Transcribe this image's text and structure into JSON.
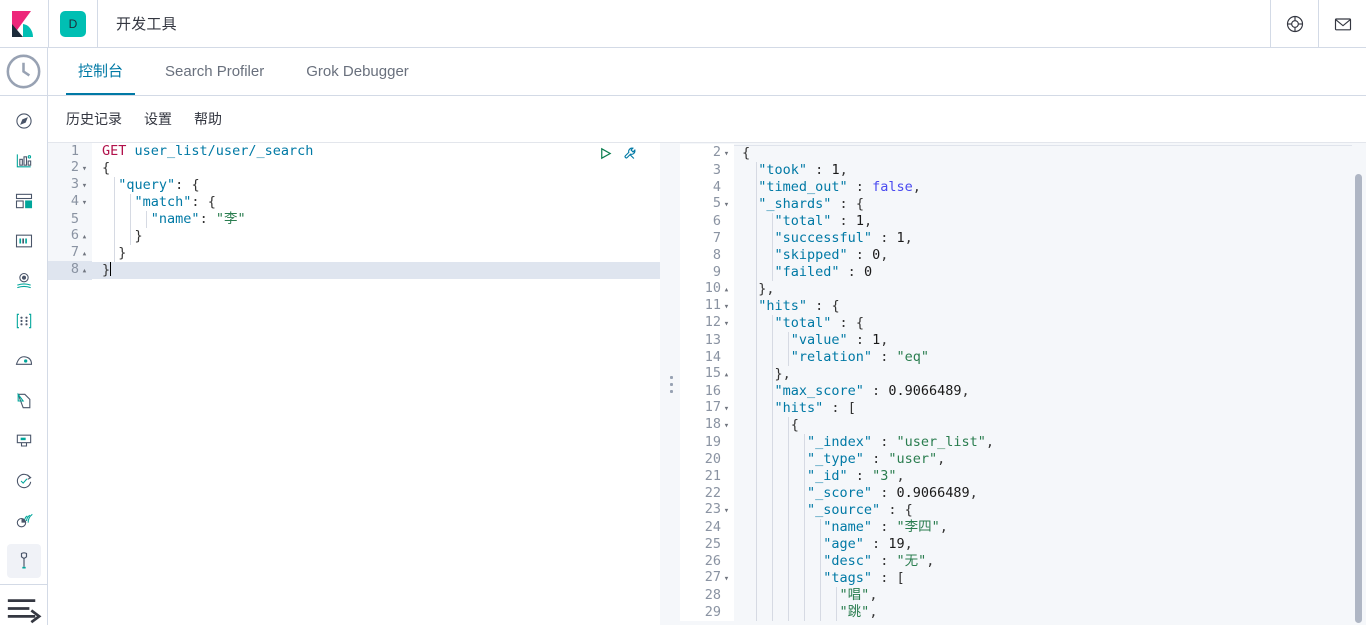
{
  "header": {
    "logo_icon": "kibana-logo",
    "space_badge": "D",
    "title": "开发工具",
    "help_icon": "lifebuoy-icon",
    "mail_icon": "envelope-icon"
  },
  "sidebar": {
    "recent_icon": "clock-icon",
    "items": [
      {
        "icon": "compass-icon",
        "name": "discover"
      },
      {
        "icon": "bar-chart-icon",
        "name": "visualize"
      },
      {
        "icon": "dashboard-icon",
        "name": "dashboard"
      },
      {
        "icon": "canvas-icon",
        "name": "canvas"
      },
      {
        "icon": "map-marker-icon",
        "name": "maps"
      },
      {
        "icon": "ml-nodes-icon",
        "name": "machine-learning"
      },
      {
        "icon": "apm-icon",
        "name": "apm"
      },
      {
        "icon": "logs-icon",
        "name": "logs"
      },
      {
        "icon": "metrics-icon",
        "name": "metrics"
      },
      {
        "icon": "uptime-icon",
        "name": "uptime"
      },
      {
        "icon": "siem-icon",
        "name": "siem"
      },
      {
        "icon": "wrench-icon",
        "name": "dev-tools",
        "active": true
      }
    ],
    "collapse_icon": "collapse-arrow-icon"
  },
  "tabs": [
    {
      "label": "控制台",
      "active": true
    },
    {
      "label": "Search Profiler",
      "active": false
    },
    {
      "label": "Grok Debugger",
      "active": false
    }
  ],
  "submenu": [
    {
      "label": "历史记录"
    },
    {
      "label": "设置"
    },
    {
      "label": "帮助"
    }
  ],
  "request_editor": {
    "play_icon": "play-triangle-icon",
    "wrench_icon": "wrench-icon",
    "active_line": 8,
    "lines": [
      {
        "n": "1",
        "fold": "",
        "indent": 0,
        "tokens": [
          {
            "t": "method",
            "v": "GET"
          },
          {
            "t": "plain",
            "v": " "
          },
          {
            "t": "url",
            "v": "user_list/user/_search"
          }
        ]
      },
      {
        "n": "2",
        "fold": "▾",
        "indent": 0,
        "tokens": [
          {
            "t": "brace",
            "v": "{"
          }
        ]
      },
      {
        "n": "3",
        "fold": "▾",
        "indent": 1,
        "tokens": [
          {
            "t": "plain",
            "v": "  "
          },
          {
            "t": "key",
            "v": "\"query\""
          },
          {
            "t": "punc",
            "v": ": "
          },
          {
            "t": "brace",
            "v": "{"
          }
        ]
      },
      {
        "n": "4",
        "fold": "▾",
        "indent": 2,
        "tokens": [
          {
            "t": "plain",
            "v": "    "
          },
          {
            "t": "key",
            "v": "\"match\""
          },
          {
            "t": "punc",
            "v": ": "
          },
          {
            "t": "brace",
            "v": "{"
          }
        ]
      },
      {
        "n": "5",
        "fold": "",
        "indent": 3,
        "tokens": [
          {
            "t": "plain",
            "v": "      "
          },
          {
            "t": "key",
            "v": "\"name\""
          },
          {
            "t": "punc",
            "v": ": "
          },
          {
            "t": "str",
            "v": "\"李\""
          }
        ]
      },
      {
        "n": "6",
        "fold": "▴",
        "indent": 2,
        "tokens": [
          {
            "t": "plain",
            "v": "    "
          },
          {
            "t": "brace",
            "v": "}"
          }
        ]
      },
      {
        "n": "7",
        "fold": "▴",
        "indent": 1,
        "tokens": [
          {
            "t": "plain",
            "v": "  "
          },
          {
            "t": "brace",
            "v": "}"
          }
        ]
      },
      {
        "n": "8",
        "fold": "▴",
        "indent": 0,
        "tokens": [
          {
            "t": "brace",
            "v": "}"
          },
          {
            "t": "caret",
            "v": ""
          }
        ]
      }
    ]
  },
  "response_editor": {
    "lines": [
      {
        "n": "2",
        "fold": "▾",
        "indent": 0,
        "tokens": [
          {
            "t": "brace",
            "v": "{"
          }
        ]
      },
      {
        "n": "3",
        "fold": "",
        "indent": 1,
        "tokens": [
          {
            "t": "plain",
            "v": "  "
          },
          {
            "t": "key",
            "v": "\"took\""
          },
          {
            "t": "punc",
            "v": " : "
          },
          {
            "t": "num",
            "v": "1"
          },
          {
            "t": "punc",
            "v": ","
          }
        ]
      },
      {
        "n": "4",
        "fold": "",
        "indent": 1,
        "tokens": [
          {
            "t": "plain",
            "v": "  "
          },
          {
            "t": "key",
            "v": "\"timed_out\""
          },
          {
            "t": "punc",
            "v": " : "
          },
          {
            "t": "bool",
            "v": "false"
          },
          {
            "t": "punc",
            "v": ","
          }
        ]
      },
      {
        "n": "5",
        "fold": "▾",
        "indent": 1,
        "tokens": [
          {
            "t": "plain",
            "v": "  "
          },
          {
            "t": "key",
            "v": "\"_shards\""
          },
          {
            "t": "punc",
            "v": " : "
          },
          {
            "t": "brace",
            "v": "{"
          }
        ]
      },
      {
        "n": "6",
        "fold": "",
        "indent": 2,
        "tokens": [
          {
            "t": "plain",
            "v": "    "
          },
          {
            "t": "key",
            "v": "\"total\""
          },
          {
            "t": "punc",
            "v": " : "
          },
          {
            "t": "num",
            "v": "1"
          },
          {
            "t": "punc",
            "v": ","
          }
        ]
      },
      {
        "n": "7",
        "fold": "",
        "indent": 2,
        "tokens": [
          {
            "t": "plain",
            "v": "    "
          },
          {
            "t": "key",
            "v": "\"successful\""
          },
          {
            "t": "punc",
            "v": " : "
          },
          {
            "t": "num",
            "v": "1"
          },
          {
            "t": "punc",
            "v": ","
          }
        ]
      },
      {
        "n": "8",
        "fold": "",
        "indent": 2,
        "tokens": [
          {
            "t": "plain",
            "v": "    "
          },
          {
            "t": "key",
            "v": "\"skipped\""
          },
          {
            "t": "punc",
            "v": " : "
          },
          {
            "t": "num",
            "v": "0"
          },
          {
            "t": "punc",
            "v": ","
          }
        ]
      },
      {
        "n": "9",
        "fold": "",
        "indent": 2,
        "tokens": [
          {
            "t": "plain",
            "v": "    "
          },
          {
            "t": "key",
            "v": "\"failed\""
          },
          {
            "t": "punc",
            "v": " : "
          },
          {
            "t": "num",
            "v": "0"
          }
        ]
      },
      {
        "n": "10",
        "fold": "▴",
        "indent": 1,
        "tokens": [
          {
            "t": "plain",
            "v": "  "
          },
          {
            "t": "brace",
            "v": "},"
          }
        ]
      },
      {
        "n": "11",
        "fold": "▾",
        "indent": 1,
        "tokens": [
          {
            "t": "plain",
            "v": "  "
          },
          {
            "t": "key",
            "v": "\"hits\""
          },
          {
            "t": "punc",
            "v": " : "
          },
          {
            "t": "brace",
            "v": "{"
          }
        ]
      },
      {
        "n": "12",
        "fold": "▾",
        "indent": 2,
        "tokens": [
          {
            "t": "plain",
            "v": "    "
          },
          {
            "t": "key",
            "v": "\"total\""
          },
          {
            "t": "punc",
            "v": " : "
          },
          {
            "t": "brace",
            "v": "{"
          }
        ]
      },
      {
        "n": "13",
        "fold": "",
        "indent": 3,
        "tokens": [
          {
            "t": "plain",
            "v": "      "
          },
          {
            "t": "key",
            "v": "\"value\""
          },
          {
            "t": "punc",
            "v": " : "
          },
          {
            "t": "num",
            "v": "1"
          },
          {
            "t": "punc",
            "v": ","
          }
        ]
      },
      {
        "n": "14",
        "fold": "",
        "indent": 3,
        "tokens": [
          {
            "t": "plain",
            "v": "      "
          },
          {
            "t": "key",
            "v": "\"relation\""
          },
          {
            "t": "punc",
            "v": " : "
          },
          {
            "t": "str",
            "v": "\"eq\""
          }
        ]
      },
      {
        "n": "15",
        "fold": "▴",
        "indent": 2,
        "tokens": [
          {
            "t": "plain",
            "v": "    "
          },
          {
            "t": "brace",
            "v": "},"
          }
        ]
      },
      {
        "n": "16",
        "fold": "",
        "indent": 2,
        "tokens": [
          {
            "t": "plain",
            "v": "    "
          },
          {
            "t": "key",
            "v": "\"max_score\""
          },
          {
            "t": "punc",
            "v": " : "
          },
          {
            "t": "num",
            "v": "0.9066489"
          },
          {
            "t": "punc",
            "v": ","
          }
        ]
      },
      {
        "n": "17",
        "fold": "▾",
        "indent": 2,
        "tokens": [
          {
            "t": "plain",
            "v": "    "
          },
          {
            "t": "key",
            "v": "\"hits\""
          },
          {
            "t": "punc",
            "v": " : "
          },
          {
            "t": "brace",
            "v": "["
          }
        ]
      },
      {
        "n": "18",
        "fold": "▾",
        "indent": 3,
        "tokens": [
          {
            "t": "plain",
            "v": "      "
          },
          {
            "t": "brace",
            "v": "{"
          }
        ]
      },
      {
        "n": "19",
        "fold": "",
        "indent": 4,
        "tokens": [
          {
            "t": "plain",
            "v": "        "
          },
          {
            "t": "key",
            "v": "\"_index\""
          },
          {
            "t": "punc",
            "v": " : "
          },
          {
            "t": "str",
            "v": "\"user_list\""
          },
          {
            "t": "punc",
            "v": ","
          }
        ]
      },
      {
        "n": "20",
        "fold": "",
        "indent": 4,
        "tokens": [
          {
            "t": "plain",
            "v": "        "
          },
          {
            "t": "key",
            "v": "\"_type\""
          },
          {
            "t": "punc",
            "v": " : "
          },
          {
            "t": "str",
            "v": "\"user\""
          },
          {
            "t": "punc",
            "v": ","
          }
        ]
      },
      {
        "n": "21",
        "fold": "",
        "indent": 4,
        "tokens": [
          {
            "t": "plain",
            "v": "        "
          },
          {
            "t": "key",
            "v": "\"_id\""
          },
          {
            "t": "punc",
            "v": " : "
          },
          {
            "t": "str",
            "v": "\"3\""
          },
          {
            "t": "punc",
            "v": ","
          }
        ]
      },
      {
        "n": "22",
        "fold": "",
        "indent": 4,
        "tokens": [
          {
            "t": "plain",
            "v": "        "
          },
          {
            "t": "key",
            "v": "\"_score\""
          },
          {
            "t": "punc",
            "v": " : "
          },
          {
            "t": "num",
            "v": "0.9066489"
          },
          {
            "t": "punc",
            "v": ","
          }
        ]
      },
      {
        "n": "23",
        "fold": "▾",
        "indent": 4,
        "tokens": [
          {
            "t": "plain",
            "v": "        "
          },
          {
            "t": "key",
            "v": "\"_source\""
          },
          {
            "t": "punc",
            "v": " : "
          },
          {
            "t": "brace",
            "v": "{"
          }
        ]
      },
      {
        "n": "24",
        "fold": "",
        "indent": 5,
        "tokens": [
          {
            "t": "plain",
            "v": "          "
          },
          {
            "t": "key",
            "v": "\"name\""
          },
          {
            "t": "punc",
            "v": " : "
          },
          {
            "t": "str",
            "v": "\"李四\""
          },
          {
            "t": "punc",
            "v": ","
          }
        ]
      },
      {
        "n": "25",
        "fold": "",
        "indent": 5,
        "tokens": [
          {
            "t": "plain",
            "v": "          "
          },
          {
            "t": "key",
            "v": "\"age\""
          },
          {
            "t": "punc",
            "v": " : "
          },
          {
            "t": "num",
            "v": "19"
          },
          {
            "t": "punc",
            "v": ","
          }
        ]
      },
      {
        "n": "26",
        "fold": "",
        "indent": 5,
        "tokens": [
          {
            "t": "plain",
            "v": "          "
          },
          {
            "t": "key",
            "v": "\"desc\""
          },
          {
            "t": "punc",
            "v": " : "
          },
          {
            "t": "str",
            "v": "\"无\""
          },
          {
            "t": "punc",
            "v": ","
          }
        ]
      },
      {
        "n": "27",
        "fold": "▾",
        "indent": 5,
        "tokens": [
          {
            "t": "plain",
            "v": "          "
          },
          {
            "t": "key",
            "v": "\"tags\""
          },
          {
            "t": "punc",
            "v": " : "
          },
          {
            "t": "brace",
            "v": "["
          }
        ]
      },
      {
        "n": "28",
        "fold": "",
        "indent": 6,
        "tokens": [
          {
            "t": "plain",
            "v": "            "
          },
          {
            "t": "str",
            "v": "\"唱\""
          },
          {
            "t": "punc",
            "v": ","
          }
        ]
      },
      {
        "n": "29",
        "fold": "",
        "indent": 6,
        "tokens": [
          {
            "t": "plain",
            "v": "            "
          },
          {
            "t": "str",
            "v": "\"跳\""
          },
          {
            "t": "punc",
            "v": ","
          }
        ]
      }
    ]
  }
}
